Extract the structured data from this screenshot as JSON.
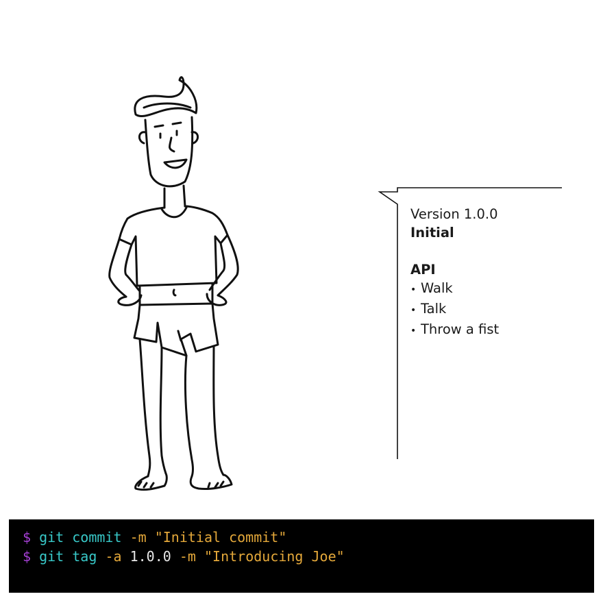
{
  "bubble": {
    "version": "Version 1.0.0",
    "heading": "Initial",
    "api_title": "API",
    "api_items": [
      "Walk",
      "Talk",
      "Throw a fist"
    ]
  },
  "terminal": {
    "lines": [
      {
        "prompt": "$",
        "command": "git commit",
        "flag": "-m",
        "value": "",
        "message": "\"Initial commit\""
      },
      {
        "prompt": "$",
        "command": "git tag",
        "flag": "-a",
        "value": "1.0.0",
        "flag2": "-m",
        "message": "\"Introducing Joe\""
      }
    ],
    "colors": {
      "background": "#000000",
      "prompt": "#a640d6",
      "command": "#38c9c9",
      "flag": "#e4a83a",
      "text": "#e8e8e8"
    }
  },
  "illustration": {
    "icon": "cartoon-man-figure"
  }
}
